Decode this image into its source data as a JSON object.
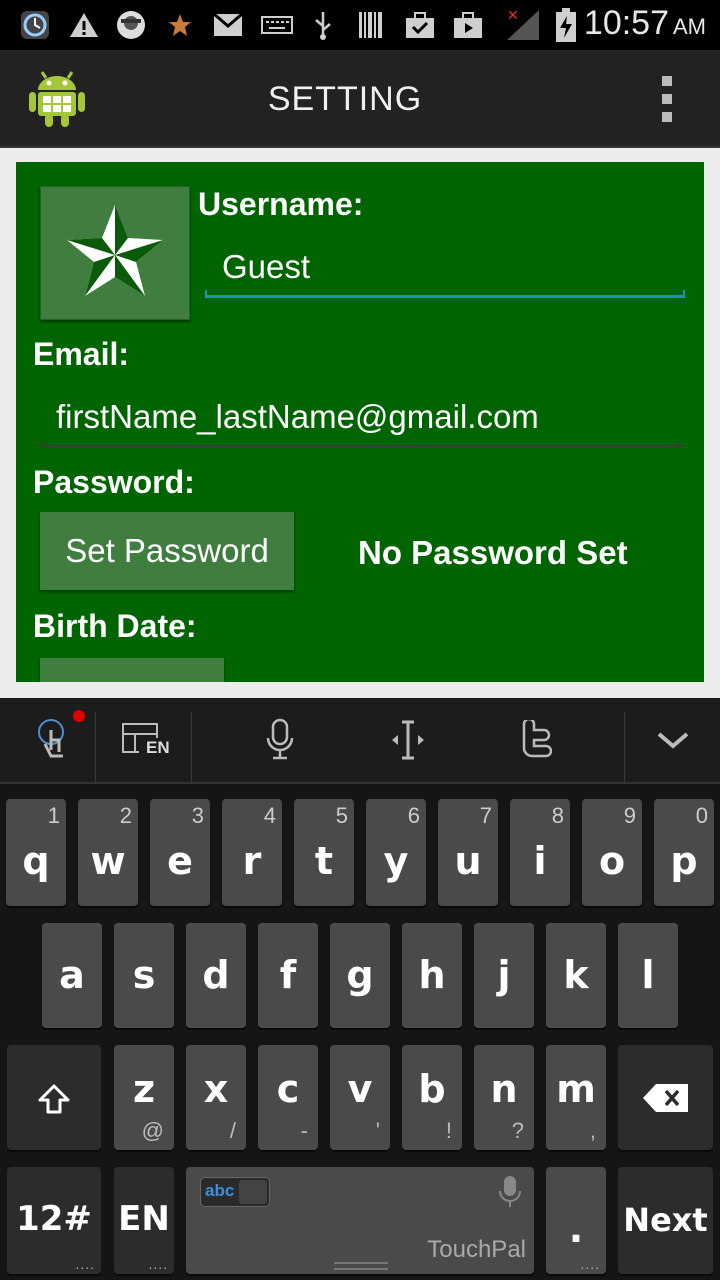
{
  "status_bar": {
    "time": "10:57",
    "ampm": "AM",
    "icons": [
      "clock-app-icon",
      "warning-icon",
      "avatar-notification-icon",
      "star-notification-icon",
      "gmail-icon",
      "keyboard-icon",
      "usb-icon",
      "barcode-icon",
      "briefcase-icon",
      "briefcase-icon",
      "signal-icon",
      "battery-charging-icon"
    ]
  },
  "action_bar": {
    "title": "SETTING"
  },
  "form": {
    "username_label": "Username:",
    "username_value": "Guest",
    "email_label": "Email:",
    "email_value": "firstName_lastName@gmail.com",
    "password_label": "Password:",
    "set_password_button": "Set Password",
    "password_status": "No Password Set",
    "birth_date_label": "Birth Date:"
  },
  "keyboard": {
    "toolbar": {
      "layout_lang": "EN"
    },
    "row1": [
      {
        "key": "q",
        "num": "1"
      },
      {
        "key": "w",
        "num": "2"
      },
      {
        "key": "e",
        "num": "3"
      },
      {
        "key": "r",
        "num": "4"
      },
      {
        "key": "t",
        "num": "5"
      },
      {
        "key": "y",
        "num": "6"
      },
      {
        "key": "u",
        "num": "7"
      },
      {
        "key": "i",
        "num": "8"
      },
      {
        "key": "o",
        "num": "9"
      },
      {
        "key": "p",
        "num": "0"
      }
    ],
    "row2": [
      "a",
      "s",
      "d",
      "f",
      "g",
      "h",
      "j",
      "k",
      "l"
    ],
    "row3": [
      {
        "key": "z",
        "sub": "@"
      },
      {
        "key": "x",
        "sub": "/"
      },
      {
        "key": "c",
        "sub": "-"
      },
      {
        "key": "v",
        "sub": "'"
      },
      {
        "key": "b",
        "sub": "!"
      },
      {
        "key": "n",
        "sub": "?"
      },
      {
        "key": "m",
        "sub": ","
      }
    ],
    "symbols_key": "12#",
    "lang_key": "EN",
    "space_mode": "abc",
    "space_brand": "TouchPal",
    "period_key": ".",
    "next_key": "Next"
  },
  "colors": {
    "panel_green": "#006400",
    "button_green": "#3f7e3f",
    "focus_underline": "#1e90c8"
  }
}
